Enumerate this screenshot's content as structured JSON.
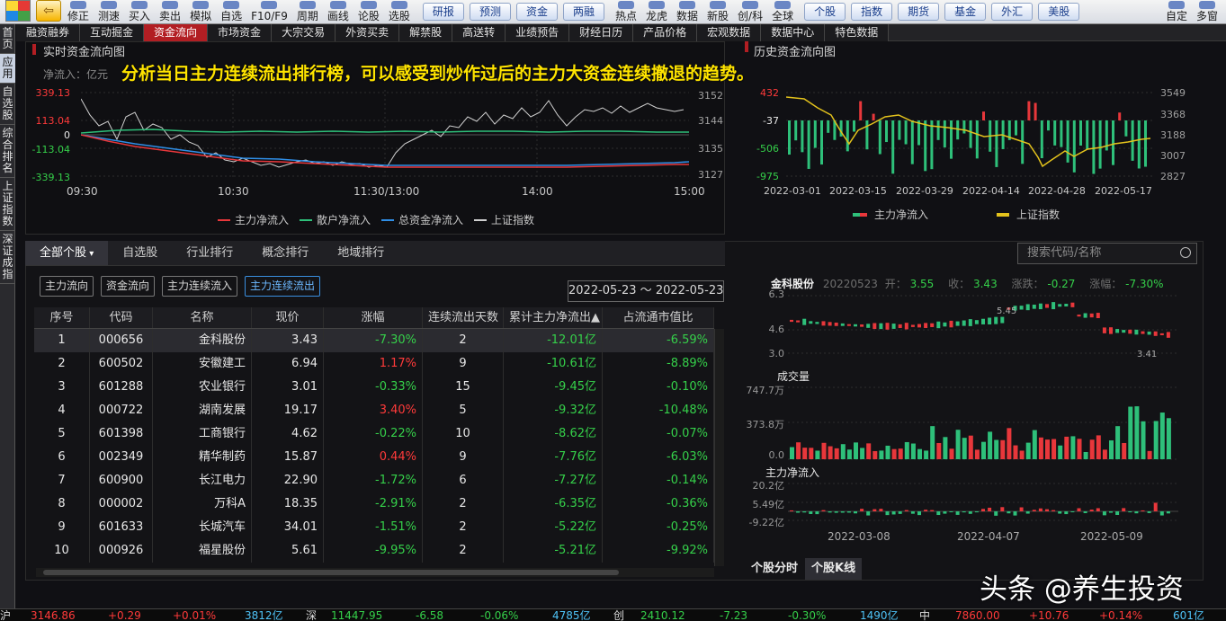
{
  "toolbar": {
    "left_buttons": [
      "修正",
      "测速",
      "买入",
      "卖出",
      "模拟",
      "自选",
      "F10/F9",
      "周期",
      "画线",
      "论股",
      "选股"
    ],
    "pills": [
      "研报",
      "预测",
      "资金",
      "两融"
    ],
    "mid_buttons": [
      "热点",
      "龙虎",
      "数据",
      "新股",
      "创/科",
      "全球"
    ],
    "right_pills": [
      "个股",
      "指数",
      "期货",
      "基金",
      "外汇",
      "美股"
    ],
    "end_buttons": [
      "自定",
      "多窗"
    ]
  },
  "left_tabs": [
    "首页",
    "应用",
    "自选股",
    "综合排名",
    "上证指数",
    "深证成指"
  ],
  "nav_tabs": [
    "融资融券",
    "互动掘金",
    "资金流向",
    "市场资金",
    "大宗交易",
    "外资买卖",
    "解禁股",
    "高送转",
    "业绩预告",
    "财经日历",
    "产品价格",
    "宏观数据",
    "数据中心",
    "特色数据"
  ],
  "nav_active": 2,
  "caption": "分析当日主力连续流出排行榜，可以感受到炒作过后的主力大资金连续撤退的趋势。",
  "realtime": {
    "title": "实时资金流向图",
    "unit": "净流入：亿元",
    "left_axis": [
      "339.13",
      "113.04",
      "0",
      "-113.04",
      "-339.13"
    ],
    "right_axis": [
      "3152",
      "3144",
      "3135",
      "3127"
    ],
    "x_labels": [
      "09:30",
      "10:30",
      "11:30/13:00",
      "14:00",
      "15:00"
    ],
    "legend": [
      {
        "label": "主力净流入",
        "color": "#e8373b"
      },
      {
        "label": "散户净流入",
        "color": "#2ec07a"
      },
      {
        "label": "总资金净流入",
        "color": "#2f8ee6"
      },
      {
        "label": "上证指数",
        "color": "#d0d0d0"
      }
    ]
  },
  "history": {
    "title": "历史资金流向图",
    "left_axis": [
      "432",
      "-37",
      "-506",
      "-975"
    ],
    "right_axis": [
      "3549",
      "3368",
      "3188",
      "3007",
      "2827"
    ],
    "x_labels": [
      "2022-03-01",
      "2022-03-15",
      "2022-03-29",
      "2022-04-14",
      "2022-04-28",
      "2022-05-17"
    ],
    "legend": [
      {
        "label": "主力净流入",
        "color": "#e8373b"
      },
      {
        "label": "上证指数",
        "color": "#e3c21c"
      }
    ]
  },
  "list": {
    "sub_tabs": [
      "全部个股",
      "自选股",
      "行业排行",
      "概念排行",
      "地域排行"
    ],
    "search_placeholder": "搜索代码/名称",
    "filters": [
      "主力流向",
      "资金流向",
      "主力连续流入",
      "主力连续流出"
    ],
    "filter_active": 3,
    "date_range": "2022-05-23 ～ 2022-05-23",
    "columns": [
      "序号",
      "代码",
      "名称",
      "现价",
      "涨幅",
      "连续流出天数",
      "累计主力净流出▲",
      "占流通市值比"
    ],
    "rows": [
      {
        "no": "1",
        "code": "000656",
        "name": "金科股份",
        "price": "3.43",
        "chg": "-7.30%",
        "days": "2",
        "net": "-12.01亿",
        "ratio": "-6.59%",
        "dir": "dn"
      },
      {
        "no": "2",
        "code": "600502",
        "name": "安徽建工",
        "price": "6.94",
        "chg": "1.17%",
        "days": "9",
        "net": "-10.61亿",
        "ratio": "-8.89%",
        "dir": "up"
      },
      {
        "no": "3",
        "code": "601288",
        "name": "农业银行",
        "price": "3.01",
        "chg": "-0.33%",
        "days": "15",
        "net": "-9.45亿",
        "ratio": "-0.10%",
        "dir": "dn"
      },
      {
        "no": "4",
        "code": "000722",
        "name": "湖南发展",
        "price": "19.17",
        "chg": "3.40%",
        "days": "5",
        "net": "-9.32亿",
        "ratio": "-10.48%",
        "dir": "up"
      },
      {
        "no": "5",
        "code": "601398",
        "name": "工商银行",
        "price": "4.62",
        "chg": "-0.22%",
        "days": "10",
        "net": "-8.62亿",
        "ratio": "-0.07%",
        "dir": "dn"
      },
      {
        "no": "6",
        "code": "002349",
        "name": "精华制药",
        "price": "15.87",
        "chg": "0.44%",
        "days": "9",
        "net": "-7.76亿",
        "ratio": "-6.03%",
        "dir": "up"
      },
      {
        "no": "7",
        "code": "600900",
        "name": "长江电力",
        "price": "22.90",
        "chg": "-1.72%",
        "days": "6",
        "net": "-7.27亿",
        "ratio": "-0.14%",
        "dir": "dn"
      },
      {
        "no": "8",
        "code": "000002",
        "name": "万科A",
        "price": "18.35",
        "chg": "-2.91%",
        "days": "2",
        "net": "-6.35亿",
        "ratio": "-0.36%",
        "dir": "dn"
      },
      {
        "no": "9",
        "code": "601633",
        "name": "长城汽车",
        "price": "34.01",
        "chg": "-1.51%",
        "days": "2",
        "net": "-5.22亿",
        "ratio": "-0.25%",
        "dir": "dn"
      },
      {
        "no": "10",
        "code": "000926",
        "name": "福星股份",
        "price": "5.61",
        "chg": "-9.95%",
        "days": "2",
        "net": "-5.21亿",
        "ratio": "-9.92%",
        "dir": "dn"
      }
    ]
  },
  "stock": {
    "name": "金科股份",
    "date": "20220523",
    "open_label": "开：",
    "open": "3.55",
    "close_label": "收：",
    "close": "3.43",
    "chg_label": "涨跌：",
    "chg": "-0.27",
    "pct_label": "涨幅：",
    "pct": "-7.30%",
    "price_axis": [
      "6.3",
      "4.6",
      "3.0"
    ],
    "high_mark": "5.45",
    "low_mark": "3.41",
    "volume_title": "成交量",
    "volume_axis": [
      "747.7万",
      "373.8万",
      "0.0"
    ],
    "flow_title": "主力净流入",
    "flow_axis": [
      "20.2亿",
      "5.49亿",
      "-9.22亿"
    ],
    "x_labels": [
      "2022-03-08",
      "2022-04-07",
      "2022-05-09"
    ],
    "buttons": [
      "个股分时",
      "个股K线"
    ]
  },
  "status": {
    "sh_price": "3146.86",
    "sh_chg": "+0.29",
    "sh_pct": "+0.01%",
    "sh_amt": "3812亿",
    "sz_label": "深",
    "sz_price": "11447.95",
    "sz_chg": "-6.58",
    "sz_pct": "-0.06%",
    "sz_amt": "4785亿",
    "cy_label": "创",
    "cy_price": "2410.12",
    "cy_chg": "-7.23",
    "cy_pct": "-0.30%",
    "cy_amt": "1490亿",
    "zz_label": "中",
    "zz_price": "7860.00",
    "zz_chg": "+10.76",
    "zz_pct": "+0.14%",
    "zz_amt": "601亿"
  },
  "watermark": "头条 @养生投资"
}
